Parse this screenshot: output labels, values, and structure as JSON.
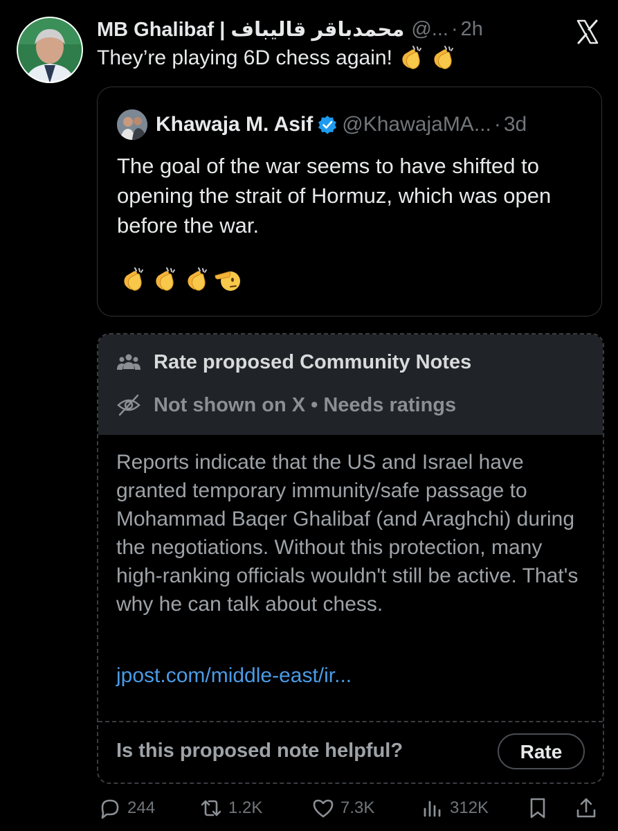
{
  "tweet": {
    "author_name": "MB Ghalibaf | محمدباقر قالیباف",
    "author_handle": "@...",
    "time": "2h",
    "text": "They’re playing 6D chess again!",
    "emojis": [
      "clapping-hands",
      "clapping-hands"
    ]
  },
  "quoted": {
    "author_name": "Khawaja M. Asif",
    "author_handle": "@KhawajaMA...",
    "time": "3d",
    "text": "The goal of the war seems to have shifted to opening the strait of Hormuz, which was open before the war.",
    "emojis": [
      "clapping-hands",
      "clapping-hands",
      "clapping-hands",
      "saluting-face"
    ]
  },
  "community_note": {
    "header": "Rate proposed Community Notes",
    "status": "Not shown on X • Needs ratings",
    "body": "Reports indicate that the US and Israel have granted temporary immunity/safe passage to Mohammad Baqer Ghalibaf (and Araghchi) during the negotiations. Without this protection, many high-ranking officials wouldn't still be active. That's why he can talk about chess.",
    "link": "jpost.com/middle-east/ir...",
    "question": "Is this proposed note helpful?",
    "rate_label": "Rate"
  },
  "actions": {
    "replies": "244",
    "reposts": "1.2K",
    "likes": "7.3K",
    "views": "312K"
  },
  "colors": {
    "background": "#000000",
    "text": "#e7e9ea",
    "muted": "#71767b",
    "link": "#4a9be6",
    "verified": "#1d9bf0"
  }
}
